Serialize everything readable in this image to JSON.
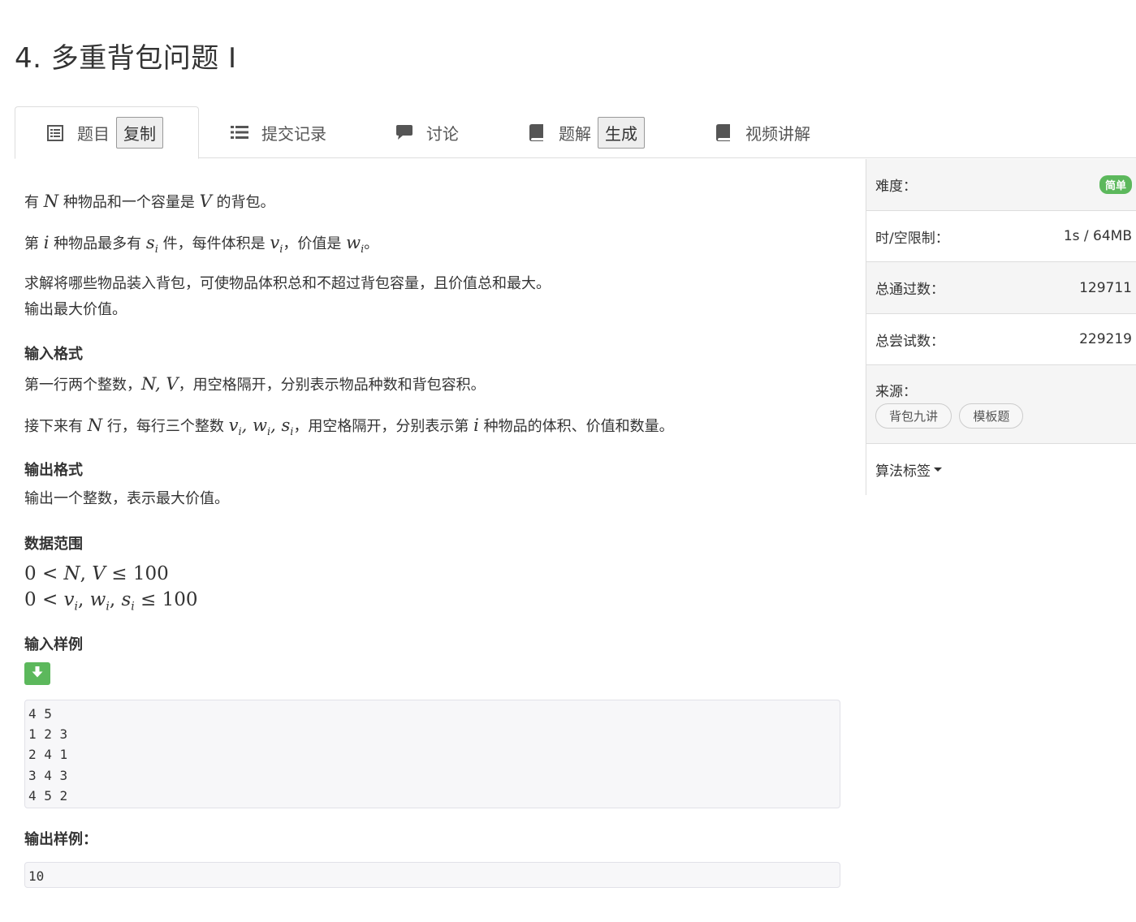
{
  "problem": {
    "title": "4. 多重背包问题 I"
  },
  "tabs": [
    {
      "label": "题目",
      "icon": "list-alt-icon",
      "button": "复制"
    },
    {
      "label": "提交记录",
      "icon": "list-icon"
    },
    {
      "label": "讨论",
      "icon": "comment-icon"
    },
    {
      "label": "题解",
      "icon": "book-icon",
      "button": "生成"
    },
    {
      "label": "视频讲解",
      "icon": "book-icon"
    }
  ],
  "statement": {
    "p1": {
      "a": "有 ",
      "N": "N",
      "b": " 种物品和一个容量是 ",
      "V": "V",
      "c": " 的背包。"
    },
    "p2": {
      "a": "第 ",
      "i": "i",
      "b": " 种物品最多有 ",
      "s": "s",
      "si": "i",
      "c": " 件，每件体积是 ",
      "v": "v",
      "vi": "i",
      "d": "，价值是 ",
      "w": "w",
      "wi": "i",
      "e": "。"
    },
    "p3": "求解将哪些物品装入背包，可使物品体积总和不超过背包容量，且价值总和最大。",
    "p4": "输出最大价值。",
    "input_heading": "输入格式",
    "input_p1": {
      "a": "第一行两个整数，",
      "N": "N",
      "sep": ", ",
      "V": "V",
      "b": "，用空格隔开，分别表示物品种数和背包容积。"
    },
    "input_p2": {
      "a": "接下来有 ",
      "N": "N",
      "b": " 行，每行三个整数 ",
      "v": "v",
      "vi": "i",
      "c1": ", ",
      "w": "w",
      "wi": "i",
      "c2": ", ",
      "s": "s",
      "si": "i",
      "c": "，用空格隔开，分别表示第 ",
      "i": "i",
      "d": " 种物品的体积、价值和数量。"
    },
    "output_heading": "输出格式",
    "output_p": "输出一个整数，表示最大价值。",
    "range_heading": "数据范围",
    "range1": {
      "zero": "0",
      "lt": " < ",
      "N": "N",
      "comma": ", ",
      "V": "V",
      "le": " ≤ ",
      "max": "100"
    },
    "range2": {
      "zero": "0",
      "lt": " < ",
      "v": "v",
      "vi": "i",
      "c1": ", ",
      "w": "w",
      "wi": "i",
      "c2": ", ",
      "s": "s",
      "si": "i",
      "le": " ≤ ",
      "max": "100"
    },
    "sample_in_heading": "输入样例",
    "sample_in": "4 5\n1 2 3\n2 4 1\n3 4 3\n4 5 2",
    "sample_out_heading": "输出样例：",
    "sample_out": "10"
  },
  "sidebar": {
    "difficulty_label": "难度：",
    "difficulty_value": "简单",
    "limit_label": "时/空限制：",
    "limit_value": "1s / 64MB",
    "passed_label": "总通过数：",
    "passed_value": "129711",
    "tried_label": "总尝试数：",
    "tried_value": "229219",
    "source_label": "来源：",
    "source_tags": [
      "背包九讲",
      "模板题"
    ],
    "algo_label": "算法标签"
  },
  "colors": {
    "badge_green": "#5cb85c",
    "border": "#dddddd",
    "code_bg": "#f7f7f9"
  }
}
